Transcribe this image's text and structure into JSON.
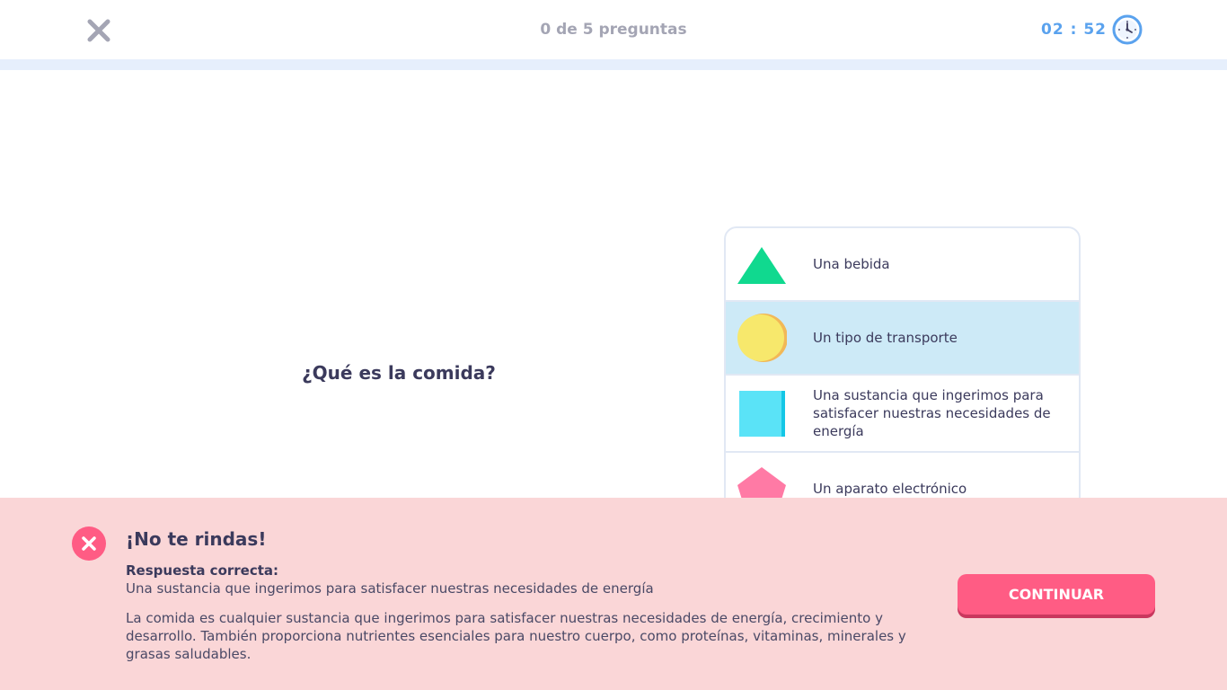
{
  "header": {
    "progress": "0 de 5 preguntas",
    "timer": "02 : 52",
    "close_icon": "close-icon",
    "clock_icon": "clock-icon",
    "progress_fraction": 0
  },
  "question": {
    "text": "¿Qué es la comida?"
  },
  "options": [
    {
      "label": "Una bebida",
      "shape": "triangle",
      "color": "#10d98f",
      "selected": false
    },
    {
      "label": "Un tipo de transporte",
      "shape": "circle",
      "color": "#f7e86c",
      "selected": true
    },
    {
      "label": "Una sustancia que ingerimos para satisfacer nuestras necesidades de energía",
      "shape": "square",
      "color": "#5ae3f7",
      "selected": false
    },
    {
      "label": "Un aparato electrónico",
      "shape": "pentagon",
      "color": "#ff7aa5",
      "selected": false
    }
  ],
  "feedback": {
    "title": "¡No te rindas!",
    "correct_label": "Respuesta correcta:",
    "correct_answer": "Una sustancia que ingerimos para satisfacer nuestras necesidades de energía",
    "explanation": "La comida es cualquier sustancia que ingerimos para satisfacer nuestras necesidades de energía, crecimiento y desarrollo. También proporciona nutrientes esenciales para nuestro cuerpo, como proteínas, vitaminas, minerales y grasas saludables.",
    "continue_label": "CONTINUAR",
    "status_icon": "error-x-icon"
  },
  "colors": {
    "accent": "#ff5c84",
    "feedback_bg": "#fad6d7",
    "selected_bg": "#cdeaf7",
    "timer": "#5aa2ee"
  }
}
